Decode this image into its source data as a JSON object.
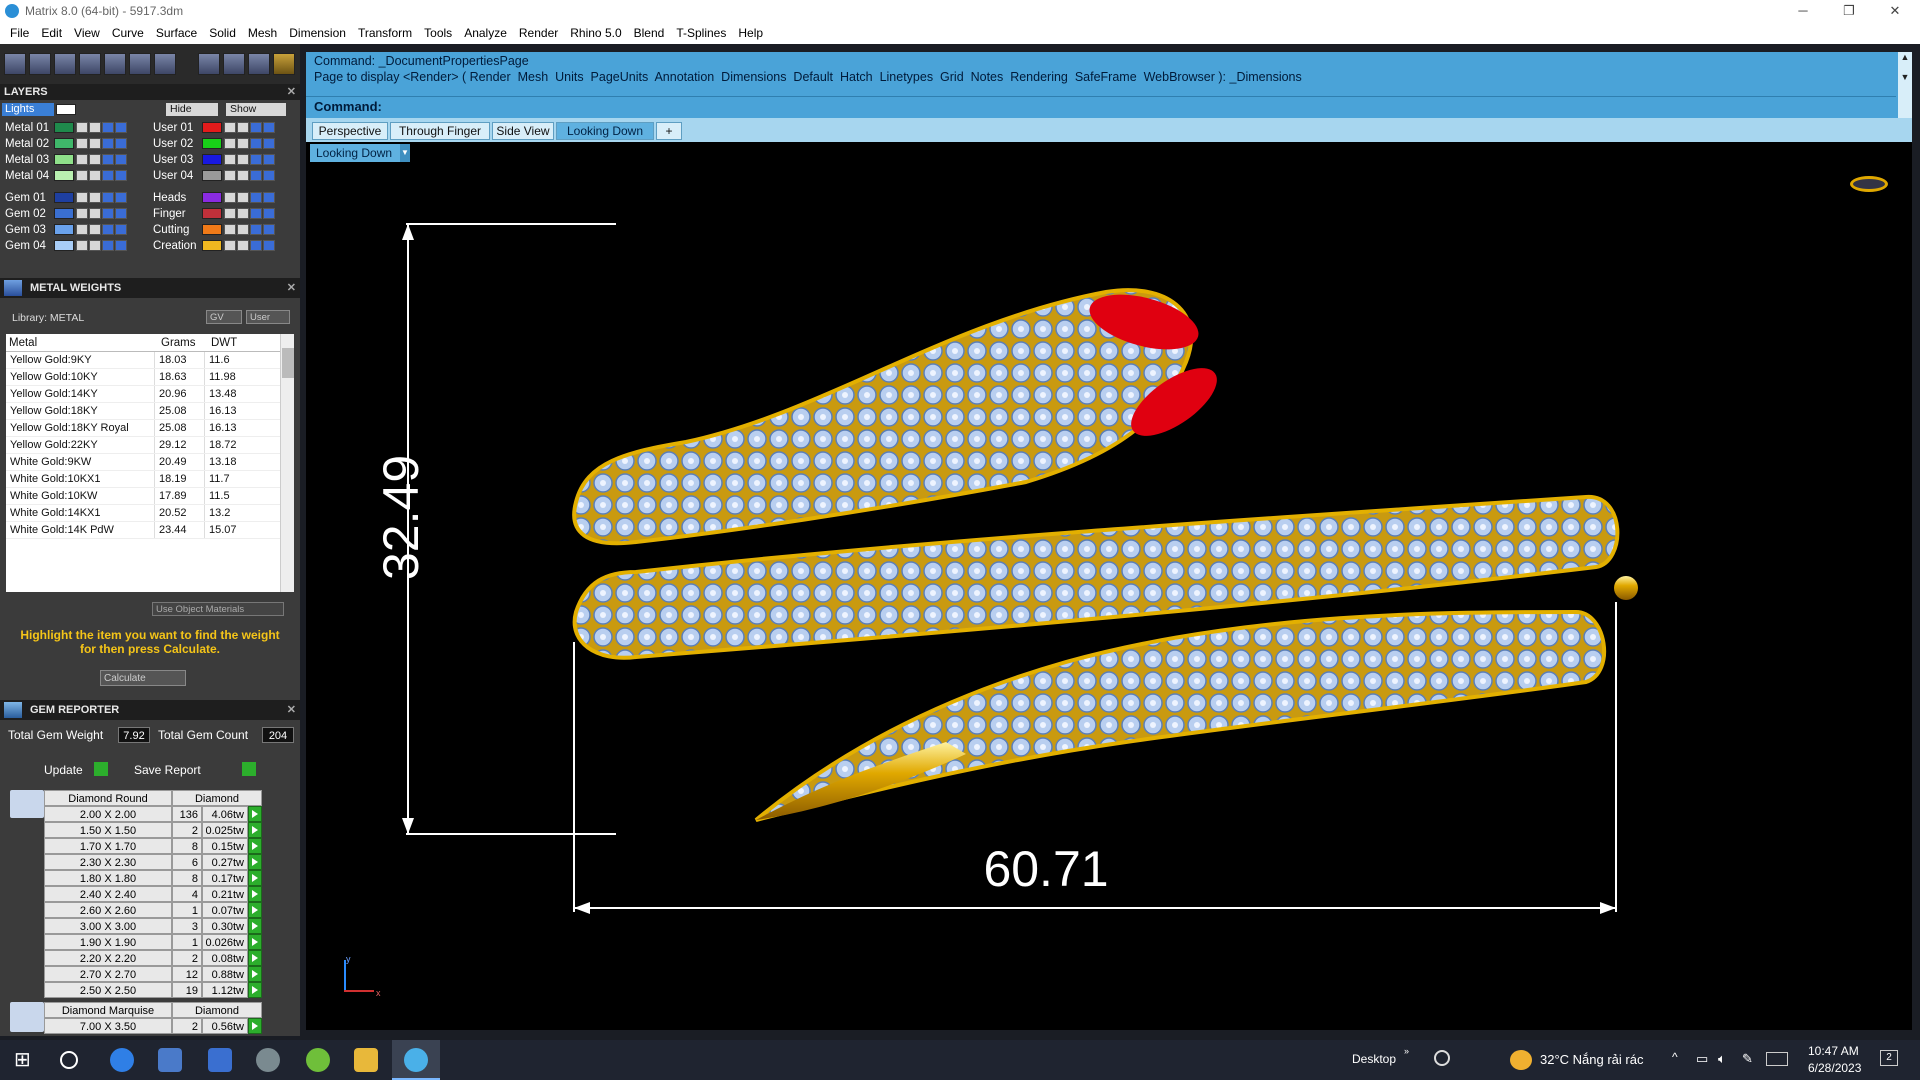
{
  "window": {
    "title": "Matrix 8.0 (64-bit) - 5917.3dm",
    "min": "─",
    "max": "❐",
    "close": "✕"
  },
  "menu": [
    "File",
    "Edit",
    "View",
    "Curve",
    "Surface",
    "Solid",
    "Mesh",
    "Dimension",
    "Transform",
    "Tools",
    "Analyze",
    "Render",
    "Rhino 5.0",
    "Blend",
    "T-Splines",
    "Help"
  ],
  "layers": {
    "title": "LAYERS",
    "lights": "Lights",
    "hide": "Hide",
    "show": "Show",
    "left": [
      {
        "name": "Metal 01",
        "color": "#1f8a4c"
      },
      {
        "name": "Metal 02",
        "color": "#3fb86a"
      },
      {
        "name": "Metal 03",
        "color": "#8fe08a"
      },
      {
        "name": "Metal 04",
        "color": "#b9f0b0"
      },
      {
        "name": "Gem 01",
        "color": "#1e3fa0"
      },
      {
        "name": "Gem 02",
        "color": "#3a6fd0"
      },
      {
        "name": "Gem 03",
        "color": "#6aa2ec"
      },
      {
        "name": "Gem 04",
        "color": "#a8cdf7"
      }
    ],
    "right": [
      {
        "name": "User 01",
        "color": "#e21b1b"
      },
      {
        "name": "User 02",
        "color": "#18d018"
      },
      {
        "name": "User 03",
        "color": "#1818e0"
      },
      {
        "name": "User 04",
        "color": "#9a9a9a"
      },
      {
        "name": "Heads",
        "color": "#8a2be2"
      },
      {
        "name": "Finger",
        "color": "#c0303a"
      },
      {
        "name": "Cutting",
        "color": "#f07a18"
      },
      {
        "name": "Creation",
        "color": "#f0b820"
      }
    ]
  },
  "metal_weights": {
    "title": "METAL WEIGHTS",
    "library": "Library: METAL",
    "gv": "GV",
    "user": "User",
    "columns": [
      "Metal",
      "Grams",
      "DWT"
    ],
    "rows": [
      [
        "Yellow Gold:9KY",
        "18.03",
        "11.6"
      ],
      [
        "Yellow Gold:10KY",
        "18.63",
        "11.98"
      ],
      [
        "Yellow Gold:14KY",
        "20.96",
        "13.48"
      ],
      [
        "Yellow Gold:18KY",
        "25.08",
        "16.13"
      ],
      [
        "Yellow Gold:18KY Royal",
        "25.08",
        "16.13"
      ],
      [
        "Yellow Gold:22KY",
        "29.12",
        "18.72"
      ],
      [
        "White Gold:9KW",
        "20.49",
        "13.18"
      ],
      [
        "White Gold:10KX1",
        "18.19",
        "11.7"
      ],
      [
        "White Gold:10KW",
        "17.89",
        "11.5"
      ],
      [
        "White Gold:14KX1",
        "20.52",
        "13.2"
      ],
      [
        "White Gold:14K PdW",
        "23.44",
        "15.07"
      ]
    ],
    "use_object_materials": "Use Object Materials",
    "hint": "Highlight the item you want to find the weight for then press Calculate.",
    "calculate": "Calculate"
  },
  "gem_reporter": {
    "title": "GEM REPORTER",
    "total_weight_label": "Total Gem Weight",
    "total_weight": "7.92",
    "total_count_label": "Total Gem Count",
    "total_count": "204",
    "update": "Update",
    "save_report": "Save Report",
    "round_header": [
      "Diamond Round",
      "Diamond"
    ],
    "round_rows": [
      [
        "2.00 X 2.00",
        "136",
        "4.06tw"
      ],
      [
        "1.50 X 1.50",
        "2",
        "0.025tw"
      ],
      [
        "1.70 X 1.70",
        "8",
        "0.15tw"
      ],
      [
        "2.30 X 2.30",
        "6",
        "0.27tw"
      ],
      [
        "1.80 X 1.80",
        "8",
        "0.17tw"
      ],
      [
        "2.40 X 2.40",
        "4",
        "0.21tw"
      ],
      [
        "2.60 X 2.60",
        "1",
        "0.07tw"
      ],
      [
        "3.00 X 3.00",
        "3",
        "0.30tw"
      ],
      [
        "1.90 X 1.90",
        "1",
        "0.026tw"
      ],
      [
        "2.20 X 2.20",
        "2",
        "0.08tw"
      ],
      [
        "2.70 X 2.70",
        "12",
        "0.88tw"
      ],
      [
        "2.50 X 2.50",
        "19",
        "1.12tw"
      ]
    ],
    "marquise_header": [
      "Diamond Marquise",
      "Diamond"
    ],
    "marquise_rows": [
      [
        "7.00 X 3.50",
        "2",
        "0.56tw"
      ]
    ]
  },
  "command": {
    "line1": "Command: _DocumentPropertiesPage",
    "line2": "Page to display <Render> ( Render  Mesh  Units  PageUnits  Annotation  Dimensions  Default  Hatch  Linetypes  Grid  Notes  Rendering  SafeFrame  WebBrowser ): _Dimensions",
    "prompt": "Command:"
  },
  "view_tabs": [
    "Perspective",
    "Through Finger",
    "Side View",
    "Looking Down",
    "+"
  ],
  "active_view": "Looking Down",
  "viewport": {
    "dim_vertical": "32.49",
    "dim_horizontal": "60.71",
    "axis_y": "y",
    "axis_x": "x"
  },
  "taskbar": {
    "desktop": "Desktop",
    "weather": "32°C  Nắng rải rác",
    "time": "10:47 AM",
    "date": "6/28/2023",
    "notif": "2"
  }
}
